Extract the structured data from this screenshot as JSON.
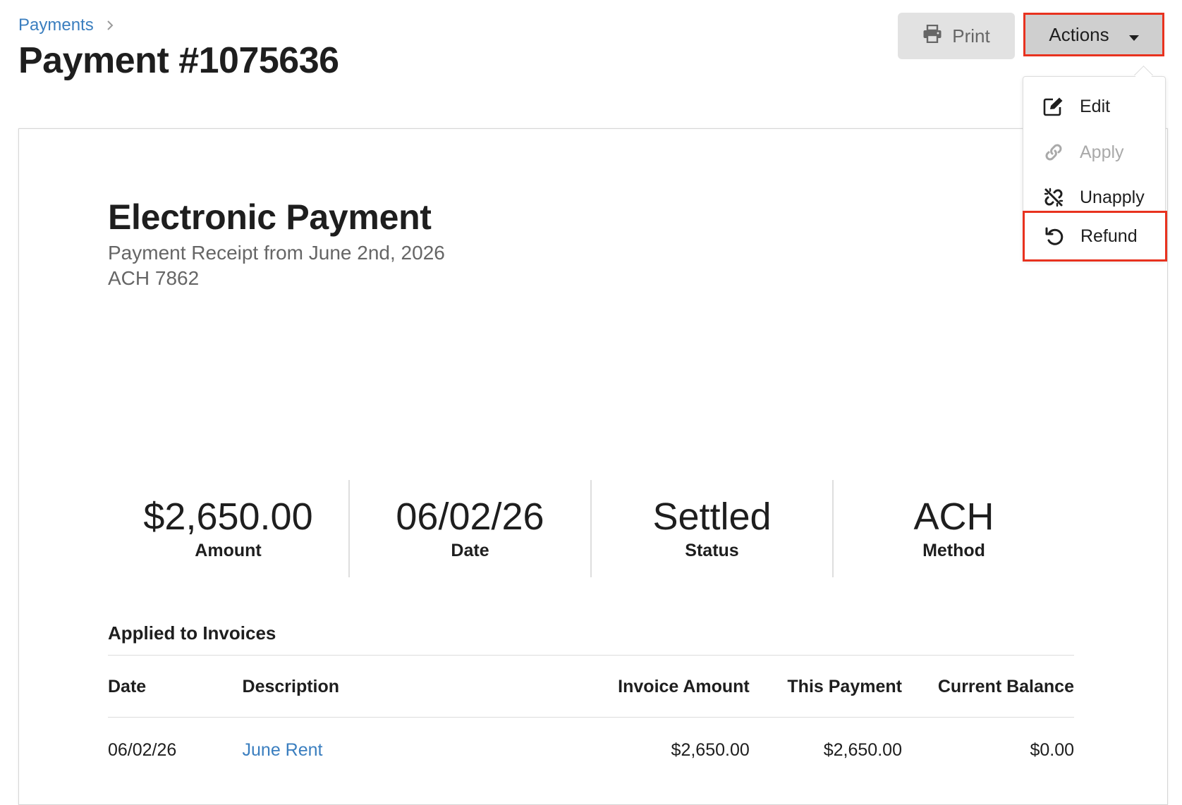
{
  "breadcrumb": {
    "parent": "Payments"
  },
  "page": {
    "title": "Payment #1075636"
  },
  "toolbar": {
    "print_label": "Print",
    "actions_label": "Actions"
  },
  "actions_menu": {
    "edit": "Edit",
    "apply": "Apply",
    "unapply": "Unapply",
    "refund": "Refund"
  },
  "receipt": {
    "title": "Electronic Payment",
    "subtitle": "Payment Receipt from June 2nd, 2026",
    "reference": "ACH 7862"
  },
  "stats": [
    {
      "value": "$2,650.00",
      "label": "Amount"
    },
    {
      "value": "06/02/26",
      "label": "Date"
    },
    {
      "value": "Settled",
      "label": "Status"
    },
    {
      "value": "ACH",
      "label": "Method"
    }
  ],
  "applied": {
    "heading": "Applied to Invoices",
    "columns": {
      "date": "Date",
      "description": "Description",
      "invoice_amount": "Invoice Amount",
      "this_payment": "This Payment",
      "current_balance": "Current Balance"
    },
    "rows": [
      {
        "date": "06/02/26",
        "description": "June Rent",
        "invoice_amount": "$2,650.00",
        "this_payment": "$2,650.00",
        "current_balance": "$0.00"
      }
    ]
  },
  "colors": {
    "link": "#3a7ebf",
    "highlight": "#e8321f",
    "disabled": "#a9a9a9"
  },
  "icons": {
    "breadcrumb_separator": "chevron-right-icon",
    "print": "printer-icon",
    "actions_toggle": "caret-down-icon",
    "edit": "edit-icon",
    "apply": "link-icon",
    "unapply": "unlink-icon",
    "refund": "undo-icon"
  }
}
